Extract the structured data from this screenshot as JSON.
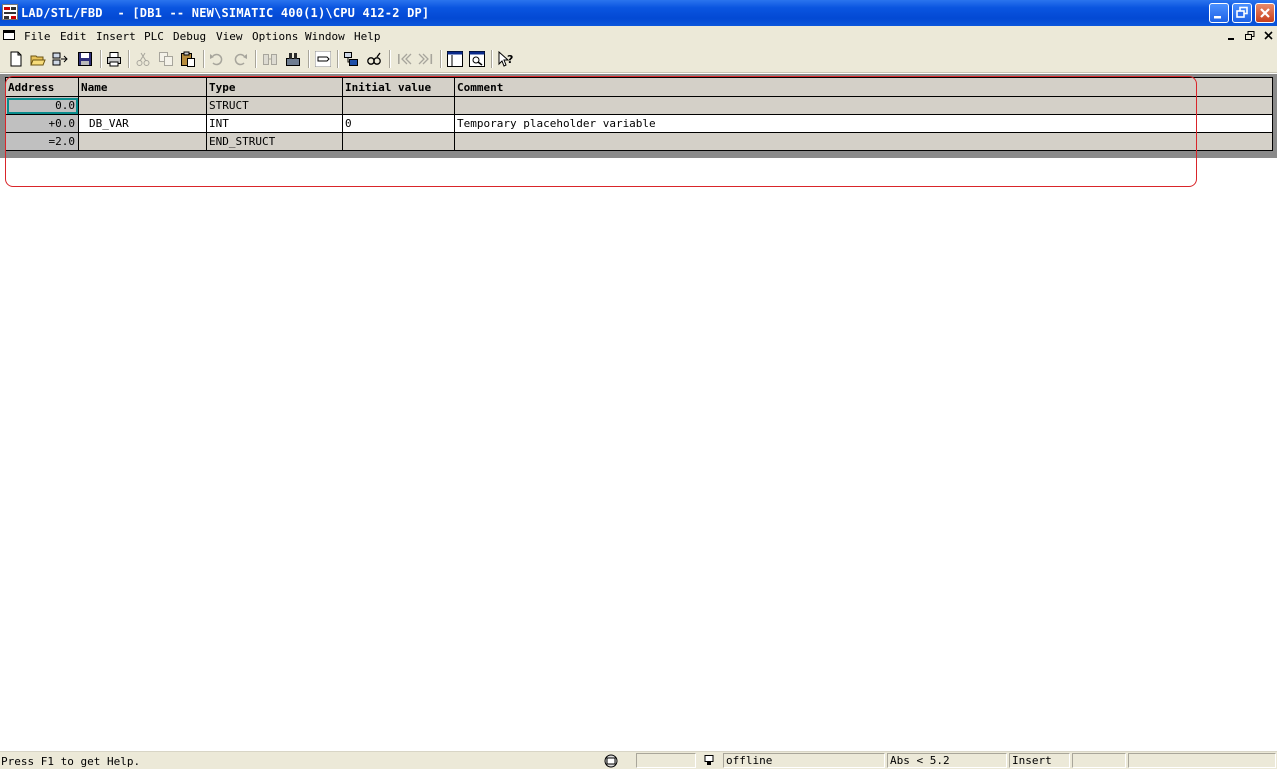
{
  "window": {
    "title": "LAD/STL/FBD  - [DB1 -- NEW\\SIMATIC 400(1)\\CPU 412-2 DP]"
  },
  "menu": {
    "items": [
      {
        "label": "File"
      },
      {
        "label": "Edit"
      },
      {
        "label": "Insert"
      },
      {
        "label": "PLC"
      },
      {
        "label": "Debug"
      },
      {
        "label": "View"
      },
      {
        "label": "Options"
      },
      {
        "label": "Window"
      },
      {
        "label": "Help"
      }
    ]
  },
  "toolbar": {
    "icons": [
      "new-icon",
      "open-icon",
      "accessible-nodes-icon",
      "save-icon",
      "print-icon",
      "cut-icon",
      "copy-icon",
      "paste-icon",
      "undo-icon",
      "redo-icon",
      "download-icon",
      "upload-icon",
      "declaration-view-icon",
      "module-state-icon",
      "monitor-icon",
      "previous-icon",
      "next-icon",
      "window-layout-icon",
      "zoom-icon",
      "whats-this-help-icon"
    ]
  },
  "table": {
    "headers": {
      "address": "Address",
      "name": "Name",
      "type": "Type",
      "initial_value": "Initial value",
      "comment": "Comment"
    },
    "rows": [
      {
        "address": "0.0",
        "name": "",
        "type": "STRUCT",
        "initial_value": "",
        "comment": ""
      },
      {
        "address": "+0.0",
        "name": "DB_VAR",
        "type": "INT",
        "initial_value": "0",
        "comment": "Temporary placeholder variable"
      },
      {
        "address": "=2.0",
        "name": "",
        "type": "END_STRUCT",
        "initial_value": "",
        "comment": ""
      }
    ]
  },
  "status": {
    "help": "Press F1 to get Help.",
    "connection": "offline",
    "version": "Abs < 5.2",
    "mode": "Insert"
  },
  "colors": {
    "titlebar": "#0a55e0",
    "annotation": "#d9252a",
    "selection": "#0a8c8c"
  }
}
